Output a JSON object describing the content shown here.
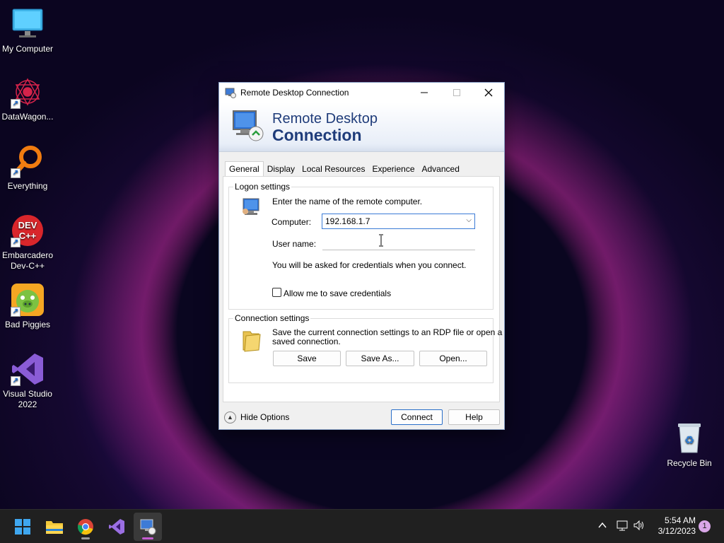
{
  "desktop": {
    "icons": [
      {
        "label": "My Computer"
      },
      {
        "label": "DataWagon..."
      },
      {
        "label": "Everything"
      },
      {
        "label": "Embarcadero\nDev-C++",
        "line1": "Embarcadero",
        "line2": "Dev-C++"
      },
      {
        "label": "Bad Piggies"
      },
      {
        "label": "Visual Studio 2022",
        "line1": "Visual Studio",
        "line2": "2022"
      },
      {
        "label": "Recycle Bin"
      }
    ]
  },
  "window": {
    "title": "Remote Desktop Connection",
    "banner_line1": "Remote Desktop",
    "banner_line2": "Connection",
    "tabs": [
      "General",
      "Display",
      "Local Resources",
      "Experience",
      "Advanced"
    ],
    "active_tab": "General",
    "logon": {
      "legend": "Logon settings",
      "instruction": "Enter the name of the remote computer.",
      "computer_label": "Computer:",
      "computer_value": "192.168.1.7",
      "username_label": "User name:",
      "username_value": "",
      "credentials_note": "You will be asked for credentials when you connect.",
      "allow_save_label": "Allow me to save credentials",
      "allow_save_checked": false
    },
    "connection": {
      "legend": "Connection settings",
      "description_line1": "Save the current connection settings to an RDP file or open a",
      "description_line2": "saved connection.",
      "save": "Save",
      "save_as": "Save As...",
      "open": "Open..."
    },
    "hide_options": "Hide Options",
    "connect": "Connect",
    "help": "Help"
  },
  "taskbar": {
    "items": [
      "start-icon",
      "file-explorer-icon",
      "chrome-icon",
      "visual-studio-icon",
      "remote-desktop-icon"
    ],
    "time": "5:54 AM",
    "date": "3/12/2023",
    "notification_count": "1"
  }
}
